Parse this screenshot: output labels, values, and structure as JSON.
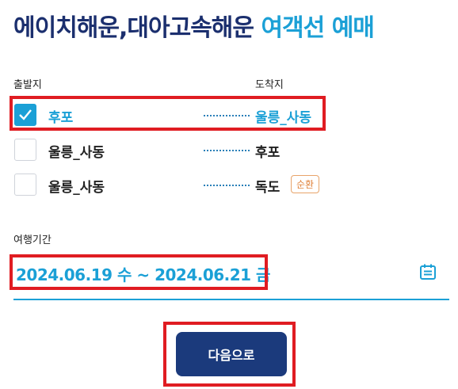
{
  "header": {
    "title_main": "에이치해운,대아고속해운",
    "title_accent": "여객선 예매"
  },
  "routes_section": {
    "departure_label": "출발지",
    "arrival_label": "도착지",
    "routes": [
      {
        "from": "후포",
        "to": "울릉_사동",
        "selected": true,
        "badge": ""
      },
      {
        "from": "울릉_사동",
        "to": "후포",
        "selected": false,
        "badge": ""
      },
      {
        "from": "울릉_사동",
        "to": "독도",
        "selected": false,
        "badge": "순환"
      }
    ]
  },
  "period": {
    "label": "여행기간",
    "value": "2024.06.19 수 ~ 2024.06.21 금",
    "icon": "calendar-icon"
  },
  "actions": {
    "next_label": "다음으로"
  },
  "colors": {
    "navy": "#1b2f6e",
    "accent": "#1ba0d6",
    "button": "#1b3a7c",
    "highlight": "#e01c22",
    "badge": "#e0823a"
  }
}
